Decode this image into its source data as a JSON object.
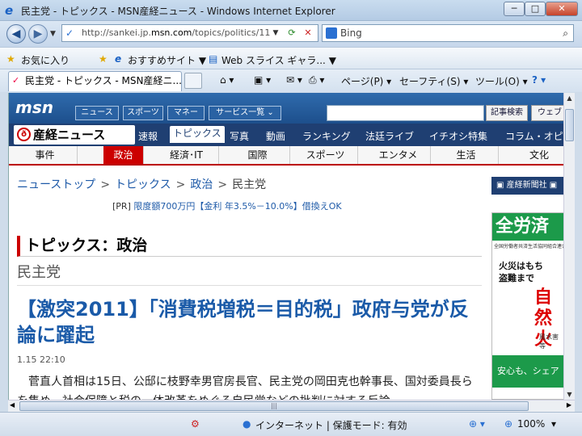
{
  "window": {
    "title": "民主党 - トピックス - MSN産経ニュース - Windows Internet Explorer",
    "min": "─",
    "max": "□",
    "close": "✕"
  },
  "nav": {
    "back": "◀",
    "forward": "▶",
    "dropdown": "▼",
    "url_prefix": "http://sankei.jp.",
    "url_domain": "msn.com",
    "url_path": "/topics/politics/11",
    "refresh": "⟳",
    "stop": "✕",
    "search_placeholder": "Bing",
    "search_icon": "⌕"
  },
  "favorites": {
    "favorites_label": "お気に入り",
    "suggested_label": "おすすめサイト ▼",
    "webslice_label": "Web スライス ギャラ... ▼"
  },
  "tabs": [
    {
      "label": "民主党 - トピックス - MSN産経ニ..."
    }
  ],
  "commands": {
    "home": "⌂ ▾",
    "feeds": "▣ ▾",
    "mail": "✉ ▾",
    "print": "⎙ ▾",
    "page": "ページ(P) ▾",
    "safety": "セーフティ(S) ▾",
    "tools": "ツール(O) ▾",
    "help": "? ▾"
  },
  "msn": {
    "logo": "msn",
    "buttons": [
      "ニュース",
      "スポーツ",
      "マネー",
      "サービス一覧 ⌄"
    ],
    "search_btn": "記事検索",
    "web_btn": "ウェブ"
  },
  "sankei": {
    "logo": "産経ニュース",
    "logo_mark": "ð",
    "nav": [
      "速報",
      "トピックス",
      "写真",
      "動画",
      "ランキング",
      "法廷ライブ",
      "イチオシ特集",
      "コラム・オピニ"
    ]
  },
  "categories": [
    "事件",
    "政治",
    "経済･IT",
    "国際",
    "スポーツ",
    "エンタメ",
    "生活",
    "文化"
  ],
  "breadcrumb": {
    "items": [
      "ニューストップ",
      "トピックス",
      "政治"
    ],
    "current": "民主党",
    "sep": ">"
  },
  "side_link": "▣ 産経新聞社 ▣",
  "pr": {
    "tag": "[PR]",
    "text": "限度額700万円【金利 年3.5%－10.0%】借換えOK"
  },
  "ad": {
    "brand": "全労済",
    "sub": "全国労働者共済生活協同組合連合会",
    "line1": "火災はもち",
    "line2": "盗難まで",
    "big": "自然火",
    "cap": "風水害等",
    "bottom": "安心も、シェア"
  },
  "article": {
    "section": "トピックス：政治",
    "category": "民主党",
    "headline": "【激突2011】「消費税増税＝目的税」政府与党が反論に躍起",
    "date": "1.15 22:10",
    "body": "菅直人首相は15日、公邸に枝野幸男官房長官、民主党の岡田克也幹事長、国対委員長らを集め、社会保障と税の一体改革をめぐる自民党などの批判に対する反論"
  },
  "status": {
    "zone": "インターネット | 保護モード: 有効",
    "zoom": "100%",
    "zoom_arrow": "▾"
  }
}
